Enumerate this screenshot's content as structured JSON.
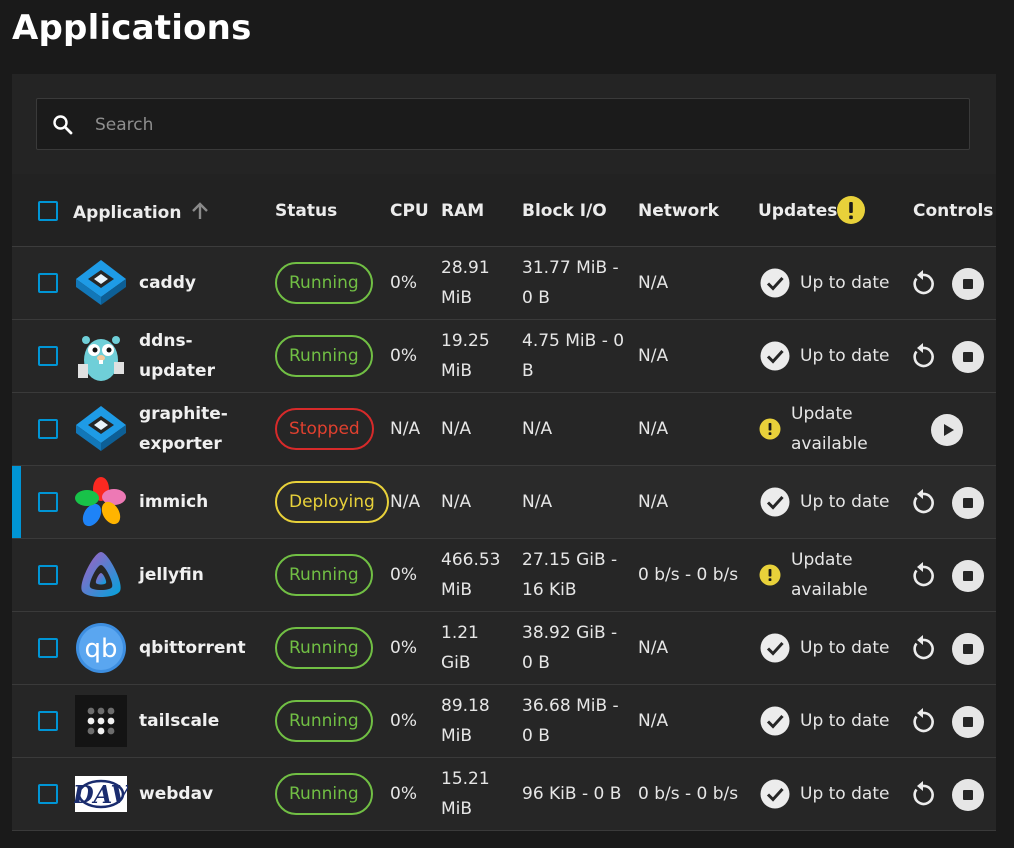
{
  "page": {
    "title": "Applications"
  },
  "search": {
    "placeholder": "Search"
  },
  "columns": {
    "application": "Application",
    "status": "Status",
    "cpu": "CPU",
    "ram": "RAM",
    "block_io": "Block I/O",
    "network": "Network",
    "updates": "Updates",
    "controls": "Controls"
  },
  "colors": {
    "accent": "#0095d5",
    "running": "#71bf44",
    "stopped": "#d72a2a",
    "deploying": "#e8d13a",
    "warning": "#e8d13a"
  },
  "apps": [
    {
      "name_l1": "caddy",
      "name_l2": "",
      "icon": "caddy-logo",
      "status": "Running",
      "cpu": "0%",
      "ram_l1": "28.91",
      "ram_l2": "MiB",
      "io_l1": "31.77 MiB -",
      "io_l2": "0 B",
      "network": "N/A",
      "update_l1": "Up to date",
      "update_l2": ""
    },
    {
      "name_l1": "ddns-",
      "name_l2": "updater",
      "icon": "gopher-logo",
      "status": "Running",
      "cpu": "0%",
      "ram_l1": "19.25",
      "ram_l2": "MiB",
      "io_l1": "4.75 MiB - 0",
      "io_l2": "B",
      "network": "N/A",
      "update_l1": "Up to date",
      "update_l2": ""
    },
    {
      "name_l1": "graphite-",
      "name_l2": "exporter",
      "icon": "caddy-logo",
      "status": "Stopped",
      "cpu": "N/A",
      "ram_l1": "N/A",
      "ram_l2": "",
      "io_l1": "N/A",
      "io_l2": "",
      "network": "N/A",
      "update_l1": "Update",
      "update_l2": "available"
    },
    {
      "name_l1": "immich",
      "name_l2": "",
      "icon": "immich-logo",
      "status": "Deploying",
      "cpu": "N/A",
      "ram_l1": "N/A",
      "ram_l2": "",
      "io_l1": "N/A",
      "io_l2": "",
      "network": "N/A",
      "update_l1": "Up to date",
      "update_l2": ""
    },
    {
      "name_l1": "jellyfin",
      "name_l2": "",
      "icon": "jellyfin-logo",
      "status": "Running",
      "cpu": "0%",
      "ram_l1": "466.53",
      "ram_l2": "MiB",
      "io_l1": "27.15 GiB -",
      "io_l2": "16 KiB",
      "network": "0 b/s - 0 b/s",
      "update_l1": "Update",
      "update_l2": "available"
    },
    {
      "name_l1": "qbittorrent",
      "name_l2": "",
      "icon": "qbittorrent-logo",
      "status": "Running",
      "cpu": "0%",
      "ram_l1": "1.21",
      "ram_l2": "GiB",
      "io_l1": "38.92 GiB -",
      "io_l2": "0 B",
      "network": "N/A",
      "update_l1": "Up to date",
      "update_l2": ""
    },
    {
      "name_l1": "tailscale",
      "name_l2": "",
      "icon": "tailscale-logo",
      "status": "Running",
      "cpu": "0%",
      "ram_l1": "89.18",
      "ram_l2": "MiB",
      "io_l1": "36.68 MiB -",
      "io_l2": "0 B",
      "network": "N/A",
      "update_l1": "Up to date",
      "update_l2": ""
    },
    {
      "name_l1": "webdav",
      "name_l2": "",
      "icon": "webdav-logo",
      "status": "Running",
      "cpu": "0%",
      "ram_l1": "15.21",
      "ram_l2": "MiB",
      "io_l1": "96 KiB - 0 B",
      "io_l2": "",
      "network": "0 b/s - 0 b/s",
      "update_l1": "Up to date",
      "update_l2": ""
    }
  ]
}
